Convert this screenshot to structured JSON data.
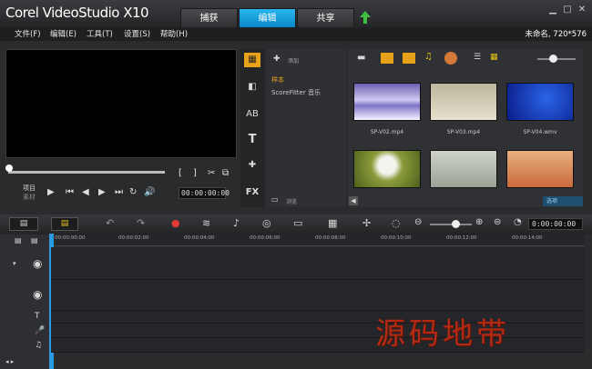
{
  "app": {
    "logo": "Corel VideoStudio X10"
  },
  "tabs": [
    {
      "label": "捕获"
    },
    {
      "label": "编辑"
    },
    {
      "label": "共享"
    }
  ],
  "menu": [
    {
      "label": "文件(F)"
    },
    {
      "label": "编辑(E)"
    },
    {
      "label": "工具(T)"
    },
    {
      "label": "设置(S)"
    },
    {
      "label": "帮助(H)"
    }
  ],
  "project_info": "未命名, 720*576",
  "player": {
    "project_label": "项目",
    "clip_label": "素材",
    "timecode": "00:00:00:00"
  },
  "library": {
    "add_label": "添加",
    "folders": [
      {
        "label": "样本"
      },
      {
        "label": "ScoreFitter 音乐"
      }
    ],
    "browse_label": "浏览",
    "options_label": "选项"
  },
  "thumbs": [
    {
      "label": "SP-V02.mp4"
    },
    {
      "label": "SP-V03.mp4"
    },
    {
      "label": "SP-V04.wmv"
    },
    {
      "label": ""
    },
    {
      "label": ""
    },
    {
      "label": ""
    }
  ],
  "timeline": {
    "timecode": "0:00:00:00",
    "ruler": [
      "00:00:00:00",
      "00:00:02:00",
      "00:00:04:00",
      "00:00:06:00",
      "00:00:08:00",
      "00:00:10:00",
      "00:00:12:00",
      "00:00:14:00"
    ]
  },
  "watermark": "源码地带",
  "colors": {
    "accent": "#1aa3e0",
    "watermark": "#b22a14"
  }
}
